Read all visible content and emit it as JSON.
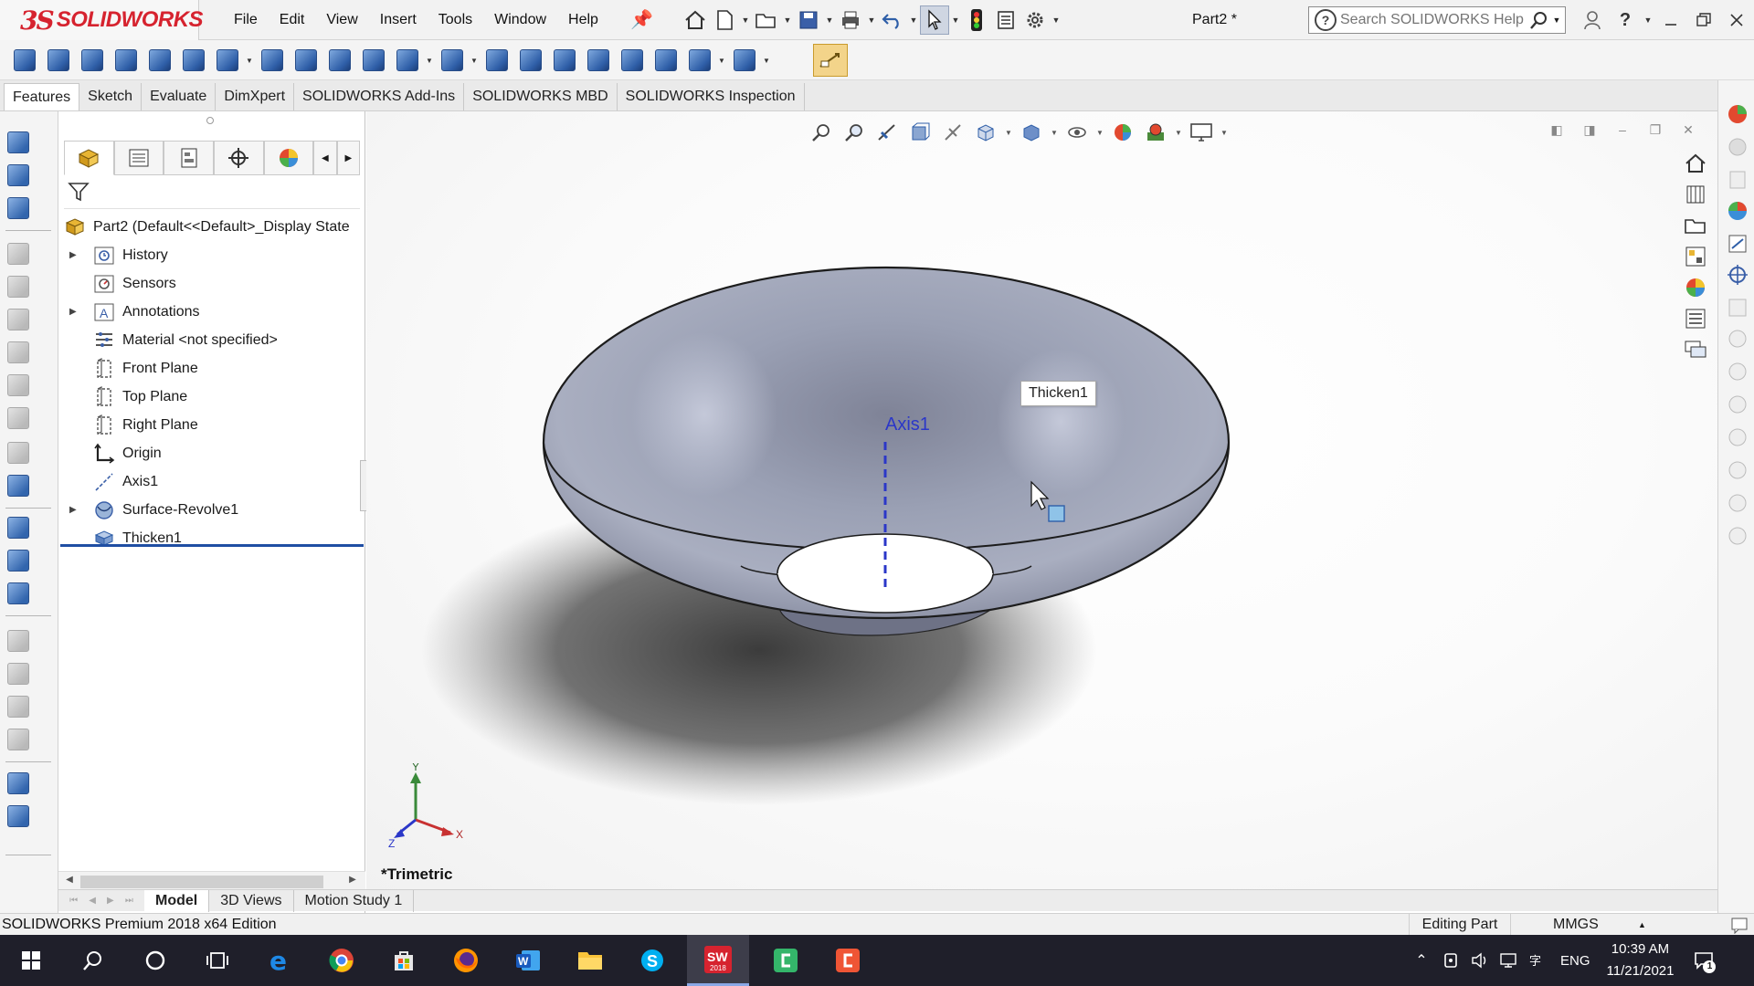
{
  "app": {
    "brand": "SOLIDWORKS",
    "document_title": "Part2 *",
    "menus": [
      "File",
      "Edit",
      "View",
      "Insert",
      "Tools",
      "Window",
      "Help"
    ],
    "help_search_placeholder": "Search SOLIDWORKS Help"
  },
  "tabs": [
    "Features",
    "Sketch",
    "Evaluate",
    "DimXpert",
    "SOLIDWORKS Add-Ins",
    "SOLIDWORKS MBD",
    "SOLIDWORKS Inspection"
  ],
  "feature_tree": {
    "root": "Part2  (Default<<Default>_Display State",
    "items": [
      {
        "label": "History",
        "icon": "history-icon",
        "expandable": true
      },
      {
        "label": "Sensors",
        "icon": "sensors-icon",
        "expandable": false
      },
      {
        "label": "Annotations",
        "icon": "annotations-icon",
        "expandable": true
      },
      {
        "label": "Material <not specified>",
        "icon": "material-icon",
        "expandable": false
      },
      {
        "label": "Front Plane",
        "icon": "plane-icon",
        "expandable": false
      },
      {
        "label": "Top Plane",
        "icon": "plane-icon",
        "expandable": false
      },
      {
        "label": "Right Plane",
        "icon": "plane-icon",
        "expandable": false
      },
      {
        "label": "Origin",
        "icon": "origin-icon",
        "expandable": false
      },
      {
        "label": "Axis1",
        "icon": "axis-icon",
        "expandable": false
      },
      {
        "label": "Surface-Revolve1",
        "icon": "surface-revolve-icon",
        "expandable": true
      },
      {
        "label": "Thicken1",
        "icon": "thicken-icon",
        "expandable": false
      }
    ]
  },
  "viewport": {
    "view_name": "*Trimetric",
    "tooltip": "Thicken1",
    "axis_label": "Axis1",
    "triad": {
      "x": "X",
      "y": "Y",
      "z": "Z"
    }
  },
  "bottom_tabs": [
    "Model",
    "3D Views",
    "Motion Study 1"
  ],
  "status": {
    "edition": "SOLIDWORKS Premium 2018 x64 Edition",
    "mode": "Editing Part",
    "units": "MMGS"
  },
  "taskbar": {
    "language": "ENG",
    "time": "10:39 AM",
    "date": "11/21/2021",
    "notification_count": "1",
    "solidworks_badge": "2018"
  },
  "colors": {
    "brand_red": "#d6232f",
    "selection_blue": "#1f4ea3",
    "axis_blue": "#2b37c8",
    "part_grey": "#8f94a8"
  }
}
